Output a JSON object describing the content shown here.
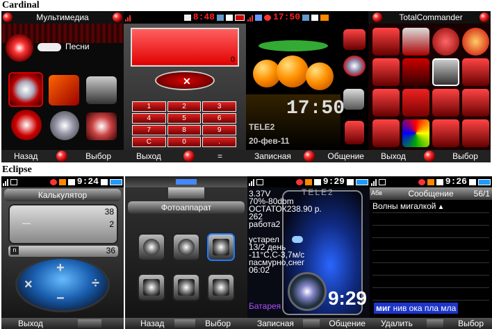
{
  "cardinal": {
    "section_title": "Cardinal",
    "p1": {
      "header": "Мультимедиа",
      "item": "Песни",
      "sk_left": "Назад",
      "sk_right": "Выбор"
    },
    "p2": {
      "time": "8:48",
      "display_value": "0",
      "keys": [
        "1",
        "2",
        "3",
        "4",
        "5",
        "6",
        "7",
        "8",
        "9",
        "C",
        "0",
        "."
      ],
      "sk_left": "Выход",
      "sk_right": "="
    },
    "p3": {
      "time": "17:50",
      "big_time": "17:50",
      "operator": "TELE2",
      "date": "20-фев-11",
      "sk_left": "Записная",
      "sk_right": "Общение"
    },
    "p4": {
      "header": "TotalCommander",
      "sk_left": "Выход",
      "sk_right": "Выбор"
    }
  },
  "eclipse": {
    "section_title": "Eclipse",
    "p1": {
      "time": "9:24",
      "header": "Калькулятор",
      "v1": "38",
      "v2": "2",
      "v3": "36",
      "op": "—",
      "sk_left": "Выход"
    },
    "p2": {
      "header": "Фотоаппарат",
      "sk_left": "Назад",
      "sk_right": "Выбор"
    },
    "p3": {
      "time": "9:29",
      "info": [
        "3.37V",
        "70%-80dbm",
        "ОСТАТОК238.90 р.",
        "262",
        "работа2",
        "",
        "устарел",
        "13/2 день",
        "-11°C,C-3,7м/с",
        "пасмурно,снег",
        "06:02"
      ],
      "operator": "TELE2",
      "battery": "Батарея",
      "big_time": "9:29",
      "sk_left": "Записная",
      "sk_right": "Общение"
    },
    "p4": {
      "time": "9:26",
      "header": "Сообщение",
      "counter": "56/1",
      "indicator": "Абв",
      "line1": "Волны мигалкой",
      "highlight": "миг",
      "rest": "нив ока пла мла",
      "sk_left": "Удалить",
      "sk_right": "Выбор"
    }
  },
  "colors": {
    "accent_red": "#c00000",
    "highlight_blue": "#1d35c8",
    "dark": "#000000"
  }
}
